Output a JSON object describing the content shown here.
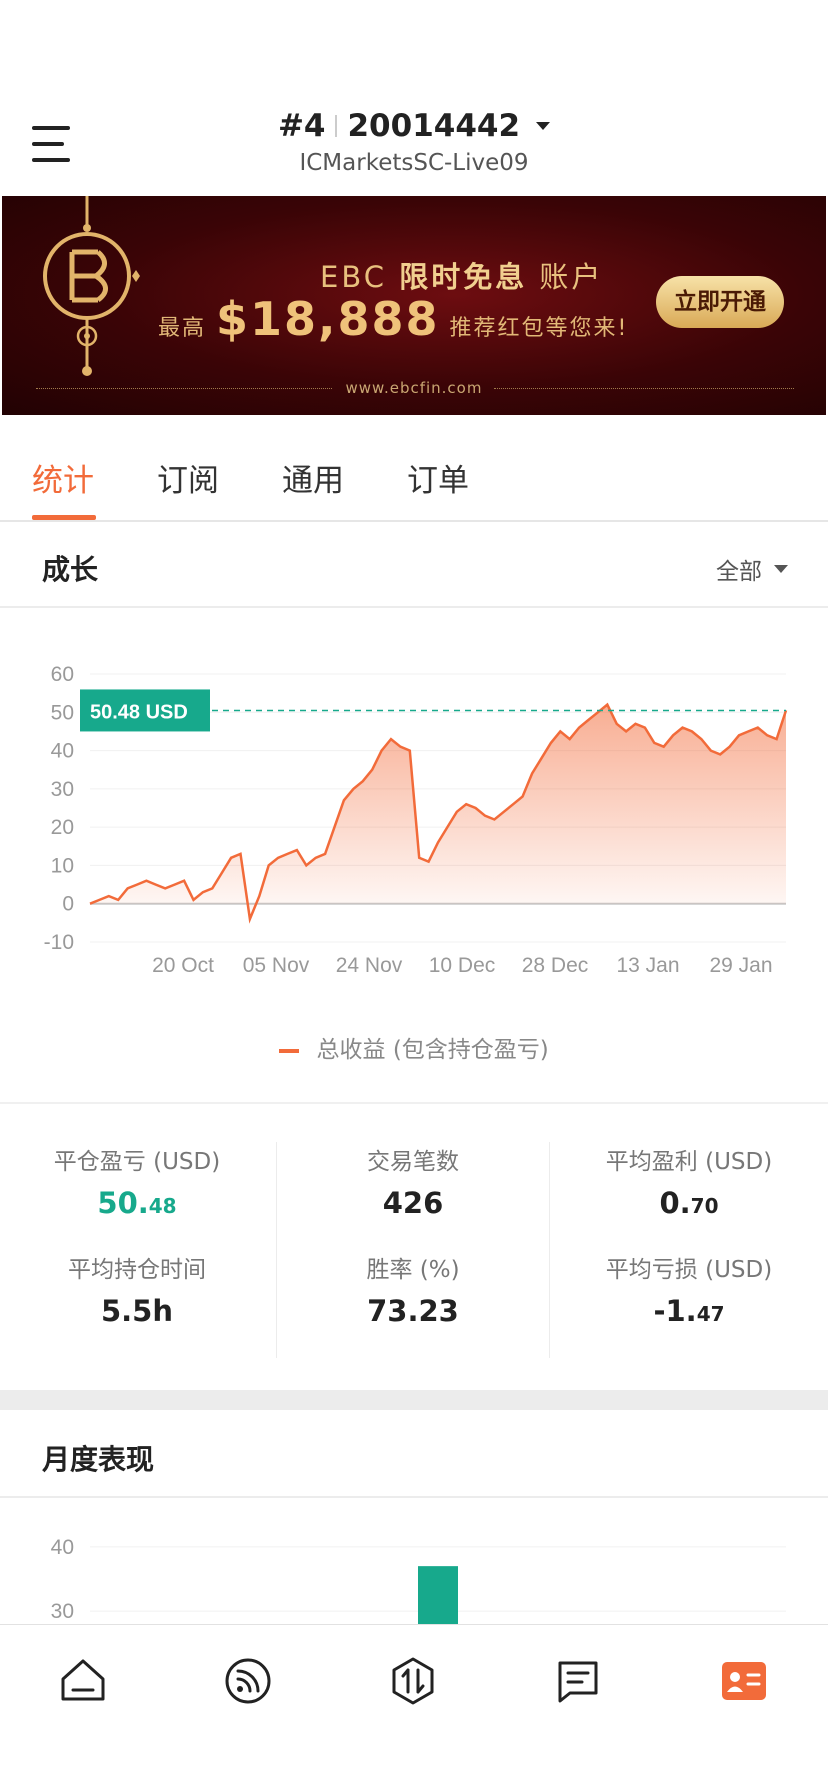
{
  "header": {
    "account_index": "#4",
    "account_number": "20014442",
    "server": "ICMarketsSC-Live09"
  },
  "banner": {
    "line1_prefix": "EBC",
    "line1_highlight": "限时免息",
    "line1_suffix": "账户",
    "line2_prefix": "最高",
    "amount": "$18,888",
    "line2_suffix": "推荐红包等您来!",
    "cta": "立即开通",
    "url": "www.ebcfin.com"
  },
  "tabs": [
    {
      "label": "统计",
      "active": true
    },
    {
      "label": "订阅",
      "active": false
    },
    {
      "label": "通用",
      "active": false
    },
    {
      "label": "订单",
      "active": false
    }
  ],
  "growth": {
    "title": "成长",
    "filter": "全部",
    "marker_label": "50.48 USD",
    "legend": "总收益 (包含持仓盈亏)"
  },
  "chart_data": [
    {
      "type": "area",
      "title": "",
      "ylim": [
        -10,
        60
      ],
      "y_ticks": [
        "60",
        "50",
        "40",
        "30",
        "20",
        "10",
        "0",
        "-10"
      ],
      "x_ticks": [
        "20 Oct",
        "05 Nov",
        "24 Nov",
        "10 Dec",
        "28 Dec",
        "13 Jan",
        "29 Jan"
      ],
      "grid": true,
      "series": [
        {
          "name": "总收益 (包含持仓盈亏)",
          "color": "#f26b3a",
          "values": [
            0,
            1,
            2,
            1,
            4,
            5,
            6,
            5,
            4,
            5,
            6,
            1,
            3,
            4,
            8,
            12,
            13,
            -4,
            2,
            10,
            12,
            13,
            14,
            10,
            12,
            13,
            20,
            27,
            30,
            32,
            35,
            40,
            43,
            41,
            40,
            12,
            11,
            16,
            20,
            24,
            26,
            25,
            23,
            22,
            24,
            26,
            28,
            34,
            38,
            42,
            45,
            43,
            46,
            48,
            50,
            52,
            47,
            45,
            47,
            46,
            42,
            41,
            44,
            46,
            45,
            43,
            40,
            39,
            41,
            44,
            45,
            46,
            44,
            43,
            50.48
          ]
        }
      ],
      "current_value": 50.48
    },
    {
      "type": "bar",
      "title": "",
      "y_ticks": [
        "40",
        "30"
      ],
      "ylim_visible": [
        28,
        42
      ],
      "series": [
        {
          "color": "#17a98c",
          "values": [
            37
          ]
        }
      ]
    }
  ],
  "stats": {
    "col1": [
      {
        "label": "平仓盈亏 (USD)",
        "int": "50.",
        "dec": "48",
        "green": true
      },
      {
        "label": "平均持仓时间",
        "int": "5.5h",
        "dec": "",
        "green": false
      }
    ],
    "col2": [
      {
        "label": "交易笔数",
        "int": "426",
        "dec": "",
        "green": false
      },
      {
        "label": "胜率 (%)",
        "int": "73.23",
        "dec": "",
        "green": false
      }
    ],
    "col3": [
      {
        "label": "平均盈利 (USD)",
        "int": "0.",
        "dec": "70",
        "green": false
      },
      {
        "label": "平均亏损 (USD)",
        "int": "-1.",
        "dec": "47",
        "green": false
      }
    ]
  },
  "monthly": {
    "title": "月度表现"
  },
  "nav": [
    {
      "icon": "home-icon"
    },
    {
      "icon": "feed-icon"
    },
    {
      "icon": "trade-icon"
    },
    {
      "icon": "news-icon"
    },
    {
      "icon": "profile-card-icon",
      "active": true
    }
  ],
  "colors": {
    "accent": "#f26b3a",
    "green": "#17a98c",
    "gold": "#e8c07e",
    "banner_bg": "#4a0609"
  }
}
